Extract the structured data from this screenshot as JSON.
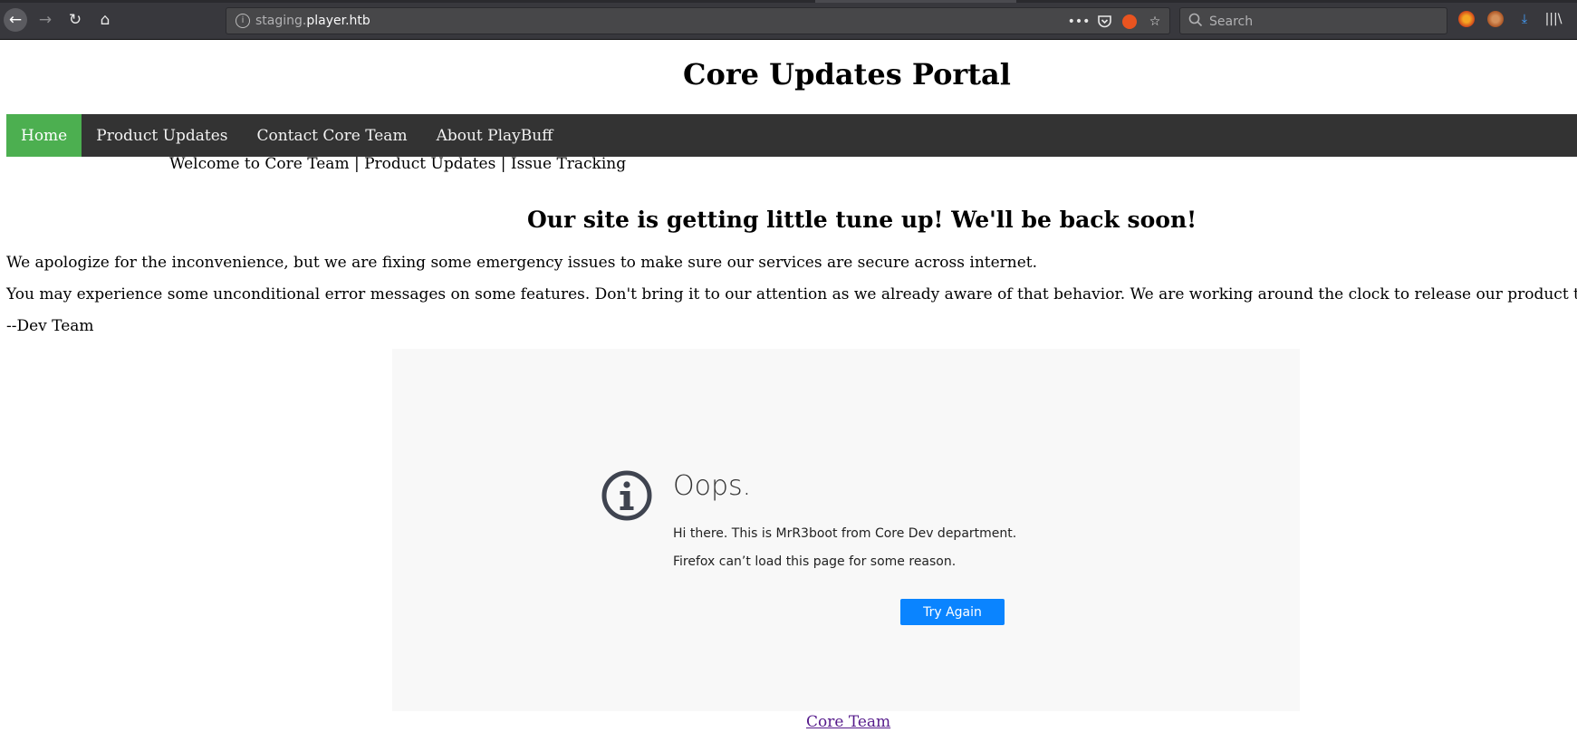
{
  "browser": {
    "url_prefix": "staging.",
    "url_host": "player.htb",
    "search_placeholder": "Search",
    "icons": [
      "back-icon",
      "forward-icon",
      "reload-icon",
      "home-icon",
      "info-icon",
      "more-icon",
      "pocket-icon",
      "ubuntu-icon",
      "bookmark-star-icon",
      "search-icon",
      "extension-icon",
      "extension-icon",
      "download-icon",
      "library-icon"
    ]
  },
  "site": {
    "title": "Core Updates Portal",
    "nav": [
      {
        "label": "Home",
        "active": true
      },
      {
        "label": "Product Updates",
        "active": false
      },
      {
        "label": "Contact Core Team",
        "active": false
      },
      {
        "label": "About PlayBuff",
        "active": false
      }
    ],
    "welcome": "Welcome to Core Team | Product Updates | Issue Tracking",
    "headline": "Our site is getting little tune up! We'll be back soon!",
    "paragraphs": [
      "We apologize for the inconvenience, but we are fixing some emergency issues to make sure our services are secure across internet.",
      "You may experience some unconditional error messages on some features. Don't bring it to our attention as we already aware of that behavior. We are working around the clock to release our product to market.",
      "--Dev Team"
    ],
    "footer_link": "Core Team"
  },
  "error_frame": {
    "title": "Oops.",
    "line1": "Hi there. This is MrR3boot from Core Dev department.",
    "line2": "Firefox can’t load this page for some reason.",
    "button_label": "Try Again"
  },
  "colors": {
    "nav_active": "#4caf50",
    "nav_bg": "#333333",
    "button": "#0a84ff",
    "link": "#551a8b"
  }
}
